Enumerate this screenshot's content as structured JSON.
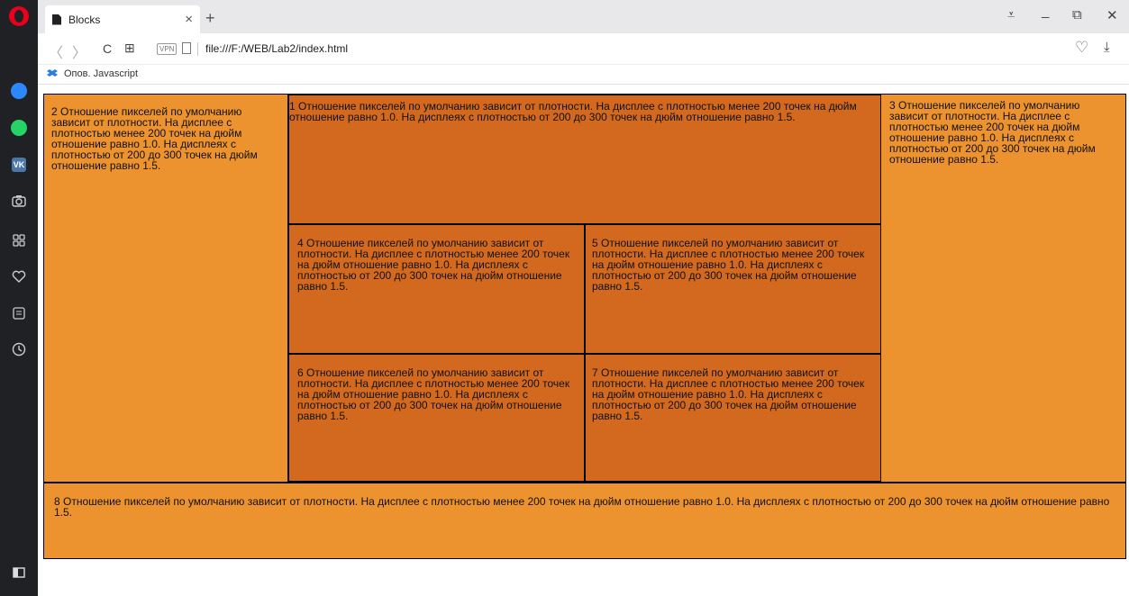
{
  "browser": {
    "tab": {
      "title": "Blocks",
      "close": "×"
    },
    "new_tab": "+",
    "window_controls": {
      "menu": "⩡",
      "minimize": "_",
      "restore": "⧉",
      "close": "✕"
    },
    "nav": {
      "back": "〈",
      "forward": "〉",
      "reload": "C",
      "speed_dial": "⊞"
    },
    "vpn_label": "VPN",
    "url": "file:///F:/WEB/Lab2/index.html",
    "heart": "♡",
    "download": "⤓",
    "bookmark": {
      "label": "Опов. Javascript"
    }
  },
  "sidebar": {
    "icons": [
      "opera-logo-icon",
      "messenger-icon",
      "whatsapp-icon",
      "vk-icon",
      "camera-icon",
      "speed-dial-icon",
      "heart-icon",
      "news-icon",
      "history-icon",
      "sidebar-toggle-icon"
    ],
    "vk_label": "VK"
  },
  "blocks": {
    "b1": "1 Отношение пикселей по умолчанию зависит от плотности. На дисплее с плотностью менее 200 точек на дюйм отношение равно 1.0. На дисплеях с плотностью от 200 до 300 точек на дюйм отношение равно 1.5.",
    "b2": "2 Отношение пикселей по умолчанию зависит от плотности. На дисплее с плотностью менее 200 точек на дюйм отношение равно 1.0. На дисплеях с плотностью от 200 до 300 точек на дюйм отношение равно 1.5.",
    "b3": "3 Отношение пикселей по умолчанию зависит от плотности. На дисплее с плотностью менее 200 точек на дюйм отношение равно 1.0. На дисплеях с плотностью от 200 до 300 точек на дюйм отношение равно 1.5.",
    "b4": "4 Отношение пикселей по умолчанию зависит от плотности. На дисплее с плотностью менее 200 точек на дюйм отношение равно 1.0. На дисплеях с плотностью от 200 до 300 точек на дюйм отношение равно 1.5.",
    "b5": "5 Отношение пикселей по умолчанию зависит от плотности. На дисплее с плотностью менее 200 точек на дюйм отношение равно 1.0. На дисплеях с плотностью от 200 до 300 точек на дюйм отношение равно 1.5.",
    "b6": "6 Отношение пикселей по умолчанию зависит от плотности. На дисплее с плотностью менее 200 точек на дюйм отношение равно 1.0. На дисплеях с плотностью от 200 до 300 точек на дюйм отношение равно 1.5.",
    "b7": "7 Отношение пикселей по умолчанию зависит от плотности. На дисплее с плотностью менее 200 точек на дюйм отношение равно 1.0. На дисплеях с плотностью от 200 до 300 точек на дюйм отношение равно 1.5.",
    "b8": "8 Отношение пикселей по умолчанию зависит от плотности. На дисплее с плотностью менее 200 точек на дюйм отношение равно 1.0. На дисплеях с плотностью от 200 до 300 точек на дюйм отношение равно 1.5."
  },
  "colors": {
    "light_orange": "#ec922e",
    "dark_orange": "#d2691e",
    "sidebar": "#1f2124"
  }
}
